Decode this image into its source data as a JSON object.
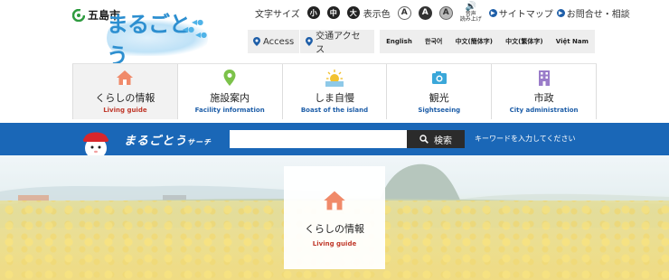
{
  "logo": {
    "city_name": "五島市",
    "title": "まるごとう"
  },
  "utility": {
    "font_size_label": "文字サイズ",
    "font_sizes": [
      "小",
      "中",
      "大"
    ],
    "color_label": "表示色",
    "color_options": [
      "A",
      "A",
      "A"
    ],
    "speech_label_1": "音声",
    "speech_label_2": "読み上げ",
    "sitemap_label": "サイトマップ",
    "contact_label": "お問合せ・相談"
  },
  "access": {
    "access_label": "Access",
    "transport_label": "交通アクセス"
  },
  "languages": [
    "English",
    "한국어",
    "中文(簡体字)",
    "中文(繁体字)",
    "Việt Nam"
  ],
  "nav": {
    "items": [
      {
        "jp": "くらしの情報",
        "en": "Living guide",
        "icon": "house-icon"
      },
      {
        "jp": "施設案内",
        "en": "Facility information",
        "icon": "map-pin-icon"
      },
      {
        "jp": "しま自慢",
        "en": "Boast of the island",
        "icon": "sunrise-icon"
      },
      {
        "jp": "観光",
        "en": "Sightseeing",
        "icon": "camera-icon"
      },
      {
        "jp": "市政",
        "en": "City administration",
        "icon": "building-icon"
      }
    ]
  },
  "search": {
    "title_main": "まるごとう",
    "title_sub": "サーチ",
    "input_value": "",
    "button_label": "検索",
    "hint": "キーワードを入力してください"
  },
  "feature": {
    "jp": "くらしの情報",
    "en": "Living guide"
  },
  "colors": {
    "brand_blue": "#1a67b7",
    "accent_red": "#c0392b",
    "link_blue": "#1e5ea8"
  }
}
